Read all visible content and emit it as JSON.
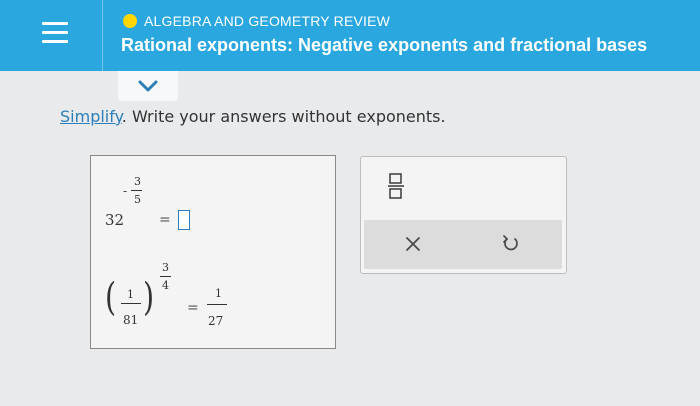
{
  "header": {
    "topic": "ALGEBRA AND GEOMETRY REVIEW",
    "title": "Rational exponents: Negative exponents and fractional bases",
    "accent_color": "#2aa7df",
    "topic_dot_color": "#ffd600"
  },
  "prompt": {
    "link_text": "Simplify",
    "rest_text": ". Write your answers without exponents."
  },
  "problems": [
    {
      "base": "32",
      "exp_sign": "-",
      "exp_num": "3",
      "exp_den": "5",
      "equals": "="
    },
    {
      "base_num": "1",
      "base_den": "81",
      "exp_num": "3",
      "exp_den": "4",
      "equals": "=",
      "answer_num": "1",
      "answer_den": "27"
    }
  ],
  "icons": {
    "menu": "hamburger-icon",
    "chevron": "chevron-down-icon",
    "fraction": "fraction-template-icon",
    "clear": "x-icon",
    "undo": "undo-icon"
  }
}
